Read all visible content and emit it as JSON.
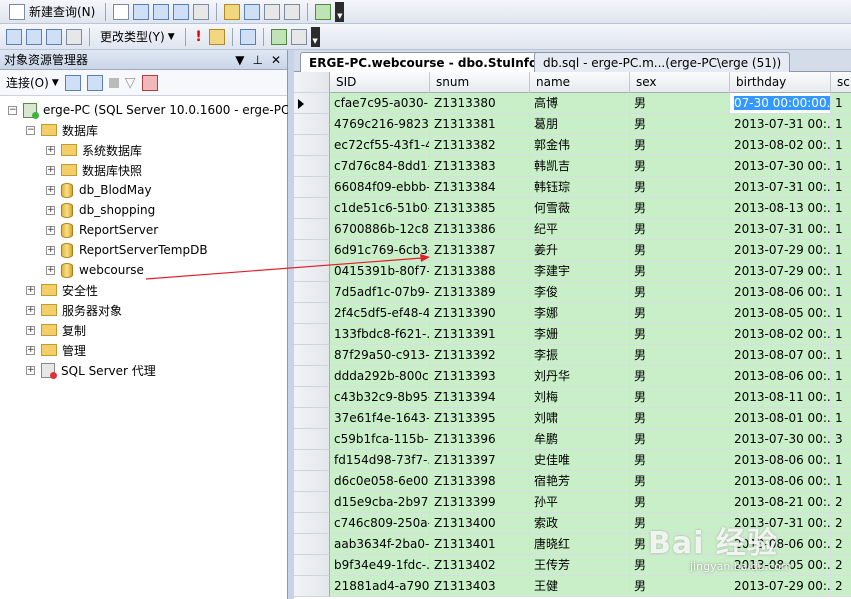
{
  "toolbar1": {
    "new_query": "新建查询(N)"
  },
  "toolbar2": {
    "change_type": "更改类型(Y)"
  },
  "object_explorer": {
    "title": "对象资源管理器",
    "connect_label": "连接(O)",
    "server": "erge-PC (SQL Server 10.0.1600 - erge-PC",
    "databases_folder": "数据库",
    "system_databases": "系统数据库",
    "database_snapshots": "数据库快照",
    "databases": [
      "db_BlodMay",
      "db_shopping",
      "ReportServer",
      "ReportServerTempDB",
      "webcourse"
    ],
    "other_nodes": [
      "安全性",
      "服务器对象",
      "复制",
      "管理"
    ],
    "agent": "SQL Server 代理"
  },
  "tabs": {
    "active": "ERGE-PC.webcourse - dbo.StuInfodb",
    "inactive": "db.sql - erge-PC.m...(erge-PC\\erge (51))"
  },
  "grid": {
    "columns": [
      "SID",
      "snum",
      "name",
      "sex",
      "birthday",
      "sch"
    ],
    "rows": [
      [
        "cfae7c95-a030-...",
        "Z1313380",
        "高博",
        "男",
        "07-30 00:00:00.000",
        "1"
      ],
      [
        "4769c216-9823-...",
        "Z1313381",
        "葛朋",
        "男",
        "2013-07-31 00:...",
        "1"
      ],
      [
        "ec72cf55-43f1-4...",
        "Z1313382",
        "郭金伟",
        "男",
        "2013-08-02 00:...",
        "1"
      ],
      [
        "c7d76c84-8dd1-...",
        "Z1313383",
        "韩凯吉",
        "男",
        "2013-07-30 00:...",
        "1"
      ],
      [
        "66084f09-ebbb-...",
        "Z1313384",
        "韩钰琮",
        "男",
        "2013-07-31 00:...",
        "1"
      ],
      [
        "c1de51c6-51b0-...",
        "Z1313385",
        "何雪薇",
        "男",
        "2013-08-13 00:...",
        "1"
      ],
      [
        "6700886b-12c8-...",
        "Z1313386",
        "纪平",
        "男",
        "2013-07-31 00:...",
        "1"
      ],
      [
        "6d91c769-6cb3-...",
        "Z1313387",
        "姜升",
        "男",
        "2013-07-29 00:...",
        "1"
      ],
      [
        "0415391b-80f7-...",
        "Z1313388",
        "李建宇",
        "男",
        "2013-07-29 00:...",
        "1"
      ],
      [
        "7d5adf1c-07b9-...",
        "Z1313389",
        "李俊",
        "男",
        "2013-08-06 00:...",
        "1"
      ],
      [
        "2f4c5df5-ef48-4...",
        "Z1313390",
        "李娜",
        "男",
        "2013-08-05 00:...",
        "1"
      ],
      [
        "133fbdc8-f621-...",
        "Z1313391",
        "李姗",
        "男",
        "2013-08-02 00:...",
        "1"
      ],
      [
        "87f29a50-c913-...",
        "Z1313392",
        "李振",
        "男",
        "2013-08-07 00:...",
        "1"
      ],
      [
        "ddda292b-800c-...",
        "Z1313393",
        "刘丹华",
        "男",
        "2013-08-06 00:...",
        "1"
      ],
      [
        "c43b32c9-8b95-...",
        "Z1313394",
        "刘梅",
        "男",
        "2013-08-11 00:...",
        "1"
      ],
      [
        "37e61f4e-1643-...",
        "Z1313395",
        "刘啸",
        "男",
        "2013-08-01 00:...",
        "1"
      ],
      [
        "c59b1fca-115b-...",
        "Z1313396",
        "牟鹏",
        "男",
        "2013-07-30 00:...",
        "3"
      ],
      [
        "fd154d98-73f7-...",
        "Z1313397",
        "史佳唯",
        "男",
        "2013-08-06 00:...",
        "1"
      ],
      [
        "d6c0e058-6e00-...",
        "Z1313398",
        "宿艳芳",
        "男",
        "2013-08-06 00:...",
        "1"
      ],
      [
        "d15e9cba-2b97-...",
        "Z1313399",
        "孙平",
        "男",
        "2013-08-21 00:...",
        "2"
      ],
      [
        "c746c809-250a-...",
        "Z1313400",
        "索政",
        "男",
        "2013-07-31 00:...",
        "2"
      ],
      [
        "aab3634f-2ba0-...",
        "Z1313401",
        "唐晓红",
        "男",
        "2013-08-06 00:...",
        "2"
      ],
      [
        "b9f34e49-1fdc-...",
        "Z1313402",
        "王传芳",
        "男",
        "2013-08-05 00:...",
        "2"
      ],
      [
        "21881ad4-a790-...",
        "Z1313403",
        "王健",
        "男",
        "2013-07-29 00:...",
        "2"
      ]
    ]
  },
  "watermark": {
    "logo": "Bai 经验",
    "url": "jingyan.baidu.com"
  }
}
